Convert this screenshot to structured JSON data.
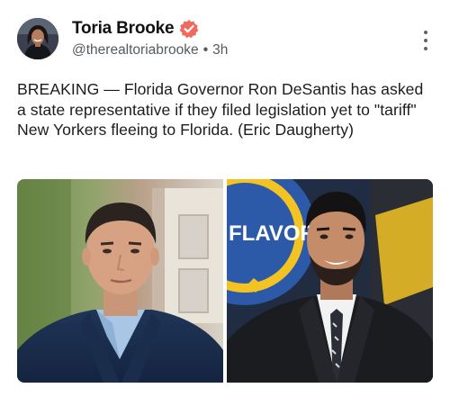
{
  "post": {
    "author": {
      "display_name": "Toria Brooke",
      "handle": "@therealtoriabrooke",
      "verified": true,
      "avatar_icon": "profile-photo"
    },
    "timestamp": "3h",
    "separator": "•",
    "text": "BREAKING — Florida Governor Ron DeSantis has asked a state representative if they filed legislation yet to \"tariff\" New Yorkers fleeing to Florida. (Eric Daugherty)",
    "menu_icon": "more-vertical-icon",
    "media": [
      {
        "name": "photo-left",
        "description_icon": "portrait-photo"
      },
      {
        "name": "photo-right",
        "description_icon": "portrait-photo",
        "sign_text": "FLAVOR"
      }
    ]
  },
  "colors": {
    "verified_badge": "#f1685e",
    "handle_text": "#555a60",
    "body_text": "#1c1c1e"
  }
}
